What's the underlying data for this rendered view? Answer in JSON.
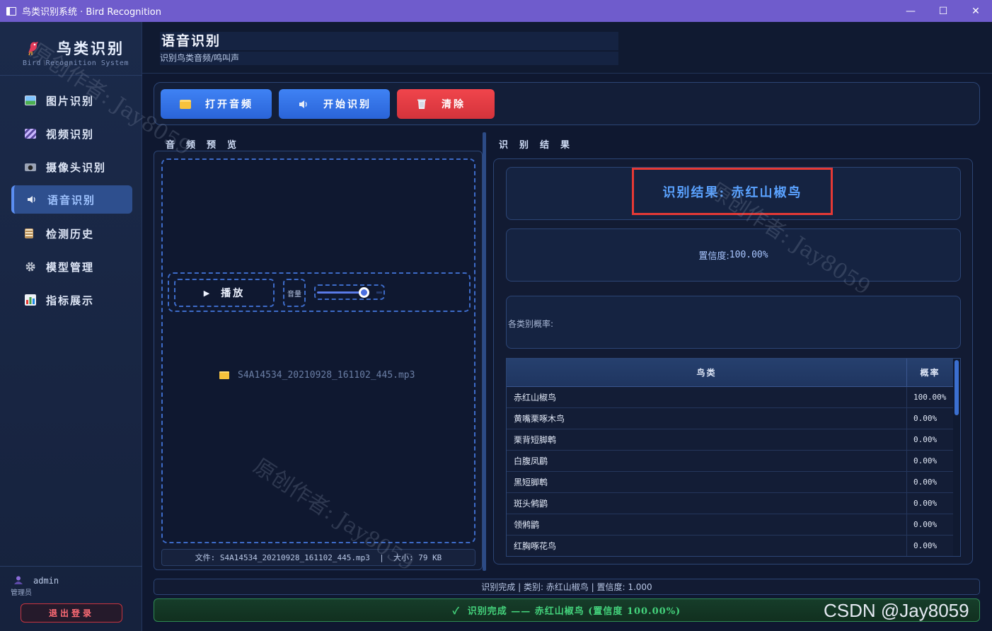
{
  "window": {
    "title": "鸟类识别系统 · Bird Recognition",
    "controls": [
      "—",
      "☐",
      "✕"
    ]
  },
  "brand": {
    "title": "鸟类识别",
    "subtitle": "Bird Recognition System"
  },
  "nav": [
    {
      "label": "图片识别",
      "icon": "image-icon",
      "active": false
    },
    {
      "label": "视频识别",
      "icon": "clapperboard-icon",
      "active": false
    },
    {
      "label": "摄像头识别",
      "icon": "camera-icon",
      "active": false
    },
    {
      "label": "语音识别",
      "icon": "speaker-icon",
      "active": true
    },
    {
      "label": "检测历史",
      "icon": "clipboard-icon",
      "active": false
    },
    {
      "label": "模型管理",
      "icon": "gear-icon",
      "active": false
    },
    {
      "label": "指标展示",
      "icon": "bar-chart-icon",
      "active": false
    }
  ],
  "user": {
    "name": "admin",
    "role": "管理员",
    "logout_label": "退出登录"
  },
  "header": {
    "title": "语音识别",
    "subtitle": "识别鸟类音频/鸣叫声"
  },
  "toolbar": {
    "open_label": "打开音频",
    "start_label": "开始识别",
    "clear_label": "清除"
  },
  "preview": {
    "section_label": "音频预览",
    "play_label": "播放",
    "play_glyph": "▶",
    "volume_label": "音量",
    "volume_level": 0.75,
    "file_name": "S4A14534_20210928_161102_445.mp3",
    "file_info": "文件: S4A14534_20210928_161102_445.mp3  |  大小: 79 KB"
  },
  "result": {
    "section_label": "识别结果",
    "result_text": "识别结果: 赤红山椒鸟",
    "confidence_label": "置信度: ",
    "confidence_value": "100.00%",
    "prob_label": "各类别概率:",
    "table_headers": {
      "name": "鸟类",
      "prob": "概率"
    },
    "rows": [
      {
        "name": "赤红山椒鸟",
        "prob": "100.00%"
      },
      {
        "name": "黄嘴栗啄木鸟",
        "prob": "0.00%"
      },
      {
        "name": "栗背短脚鹎",
        "prob": "0.00%"
      },
      {
        "name": "白腹凤鹛",
        "prob": "0.00%"
      },
      {
        "name": "黑短脚鹎",
        "prob": "0.00%"
      },
      {
        "name": "斑头鸺鹠",
        "prob": "0.00%"
      },
      {
        "name": "领鸺鹠",
        "prob": "0.00%"
      },
      {
        "name": "红胸啄花鸟",
        "prob": "0.00%"
      }
    ]
  },
  "status": {
    "line": "识别完成 | 类别: 赤红山椒鸟 | 置信度: 1.000",
    "success": "✓  识别完成 —— 赤红山椒鸟 (置信度 100.00%)"
  },
  "watermark": {
    "text": "原创作者: Jay8059",
    "csdn": "CSDN @Jay8059"
  },
  "colors": {
    "accent": "#3f82f4",
    "danger": "#e53935",
    "success": "#44d37c",
    "titlebar": "#6f5ccc"
  }
}
